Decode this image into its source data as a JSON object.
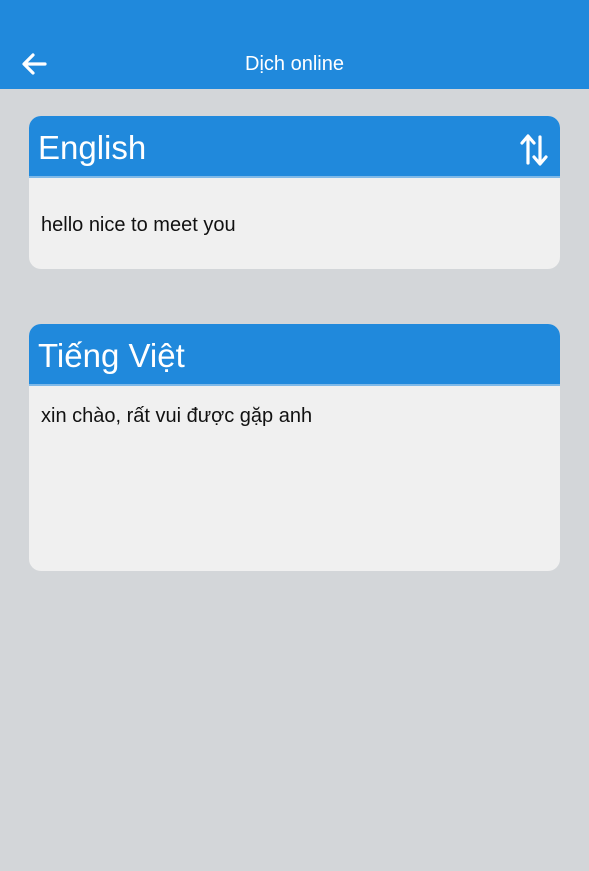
{
  "app_bar": {
    "back_icon": "arrow-left-icon",
    "title": "Dịch online",
    "background_color": "#2089dc"
  },
  "source_panel": {
    "language": "English",
    "swap_icon": "swap-vertical-icon",
    "text": "hello nice to meet you"
  },
  "target_panel": {
    "language": "Tiếng Việt",
    "text": "xin chào, rất vui được gặp anh"
  },
  "colors": {
    "accent": "#2089dc",
    "page_background": "#d3d6d9",
    "card_background": "#f0f0f0"
  }
}
